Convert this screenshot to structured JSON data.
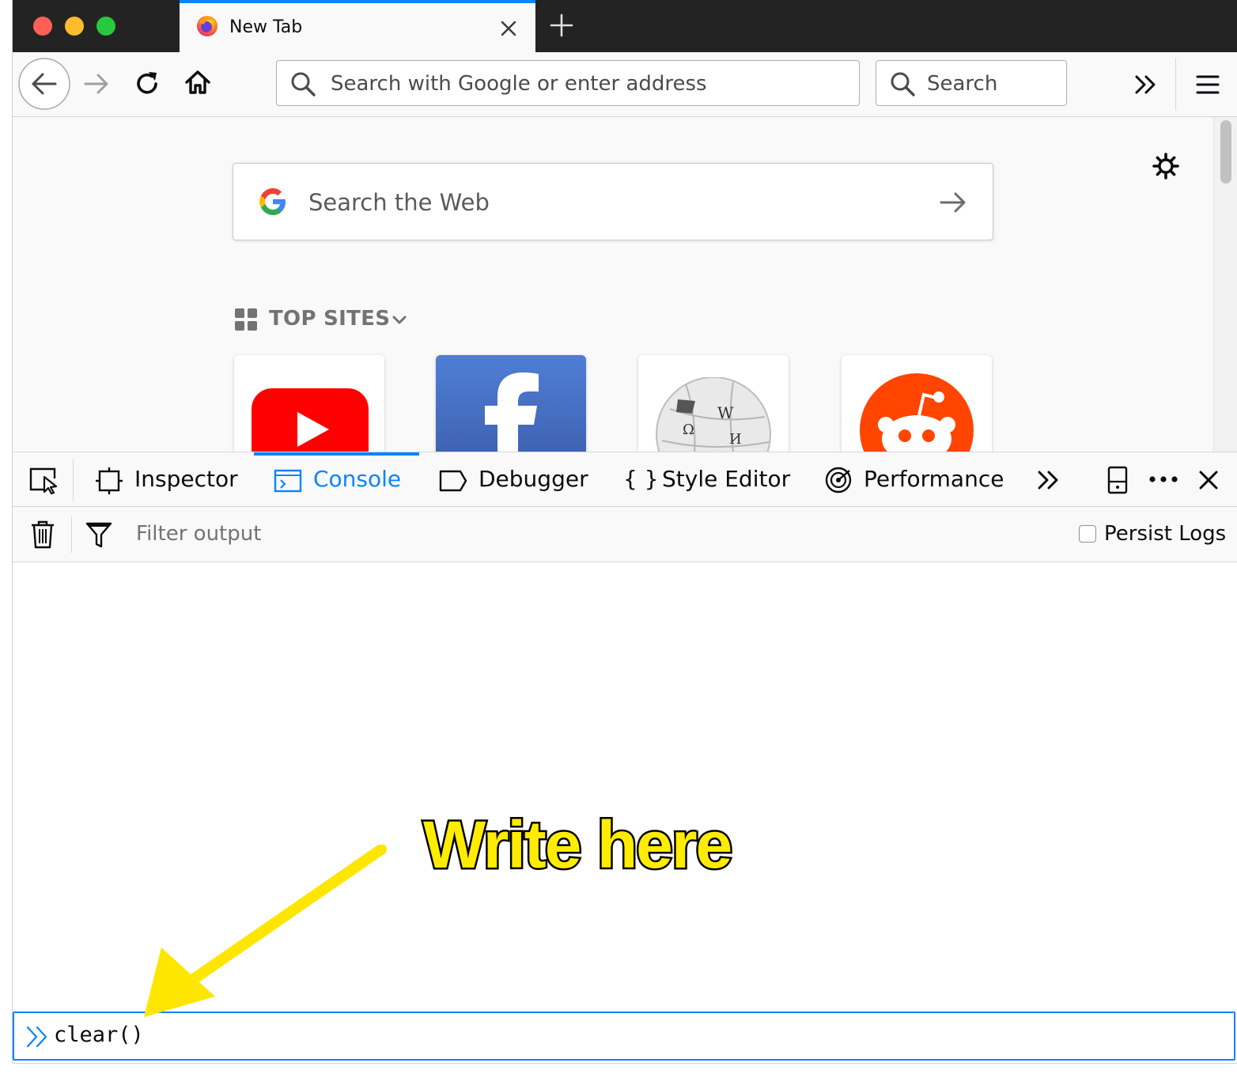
{
  "browser": {
    "tab_title": "New Tab",
    "url_placeholder": "Search with Google or enter address",
    "search_placeholder": "Search"
  },
  "newtab": {
    "web_search_placeholder": "Search the Web",
    "top_sites_label": "TOP SITES",
    "top_sites": [
      {
        "name": "youtube"
      },
      {
        "name": "facebook"
      },
      {
        "name": "wikipedia"
      },
      {
        "name": "reddit"
      }
    ]
  },
  "devtools": {
    "tabs": {
      "inspector": "Inspector",
      "console": "Console",
      "debugger": "Debugger",
      "style_editor": "Style Editor",
      "performance": "Performance"
    },
    "active_tab": "Console",
    "filter_placeholder": "Filter output",
    "persist_logs_label": "Persist Logs",
    "persist_logs_checked": false,
    "console_input_value": "clear()"
  },
  "annotation": {
    "text": "Write here",
    "color": "#ffec00"
  },
  "colors": {
    "accent": "#0a84ff",
    "titlebar": "#232323",
    "close_red": "#ff5f57",
    "minimize_yellow": "#febc2e",
    "maximize_green": "#28c840"
  }
}
